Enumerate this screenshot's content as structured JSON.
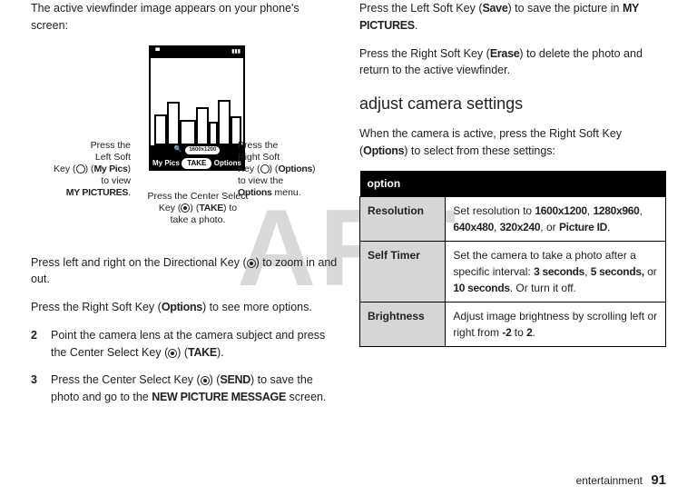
{
  "watermark": "AFT",
  "left": {
    "intro": "The active viewfinder image appears on your phone's screen:",
    "viewfinder": {
      "resolution_pill": "1600x1200",
      "softkeys": {
        "left": "My Pics",
        "center": "TAKE",
        "right": "Options"
      }
    },
    "callouts": {
      "left": {
        "l1": "Press the",
        "l2": "Left Soft",
        "l3a": "Key (",
        "l3b": ") (",
        "l3c": "My Pics",
        "l3d": ")",
        "l4": "to view",
        "l5": "MY PICTURES",
        "l5b": "."
      },
      "right": {
        "l1": "Press the",
        "l2": "Right Soft",
        "l3a": "Key (",
        "l3b": ") (",
        "l3c": "Options",
        "l3d": ")",
        "l4": "to view the",
        "l5": "Options",
        "l5b": " menu."
      },
      "bottom": {
        "l1": "Press the Center Select",
        "l2a": "Key (",
        "l2b": ") (",
        "l2c": "TAKE",
        "l2d": ") to",
        "l3": "take a photo."
      }
    },
    "zoom_a": "Press left and right on the Directional Key (",
    "zoom_b": ") to zoom in and out.",
    "options_a": "Press the Right Soft Key (",
    "options_label": "Options",
    "options_b": ") to see more options.",
    "step2": {
      "num": "2",
      "a": "Point the camera lens at the camera subject and press the Center Select Key (",
      "b": ") (",
      "take": "TAKE",
      "c": ")."
    },
    "step3": {
      "num": "3",
      "a": "Press the Center Select Key (",
      "b": ") (",
      "send": "SEND",
      "c": ") to save the photo and go to the ",
      "screen": "NEW PICTURE MESSAGE",
      "d": " screen."
    }
  },
  "right": {
    "save_a": "Press the Left Soft Key (",
    "save_label": "Save",
    "save_b": ") to save the picture in ",
    "save_dest": "MY PICTURES",
    "save_c": ".",
    "erase_a": "Press the Right Soft Key (",
    "erase_label": "Erase",
    "erase_b": ") to delete the photo and return to the active viewfinder.",
    "heading": "adjust camera settings",
    "intro_a": "When the camera is active, press the Right Soft Key (",
    "intro_label": "Options",
    "intro_b": ") to select from these settings:",
    "table": {
      "header": "option",
      "rows": [
        {
          "label": "Resolution",
          "a": "Set resolution to ",
          "v1": "1600x1200",
          "s1": ", ",
          "v2": "1280x960",
          "s2": ", ",
          "v3": "640x480",
          "s3": ", ",
          "v4": "320x240",
          "s4": ", or ",
          "v5": "Picture ID",
          "s5": "."
        },
        {
          "label": "Self Timer",
          "a": "Set the camera to take a photo after a specific interval: ",
          "v1": "3 seconds",
          "s1": ", ",
          "v2": "5 seconds,",
          "s2": " or ",
          "v3": "10 seconds",
          "s3": ". Or turn it off."
        },
        {
          "label": "Brightness",
          "a": "Adjust image brightness by scrolling left or right from ",
          "v1": "-2",
          "s1": " to ",
          "v2": "2",
          "s2": "."
        }
      ]
    }
  },
  "footer": {
    "section": "entertainment",
    "page": "91"
  }
}
